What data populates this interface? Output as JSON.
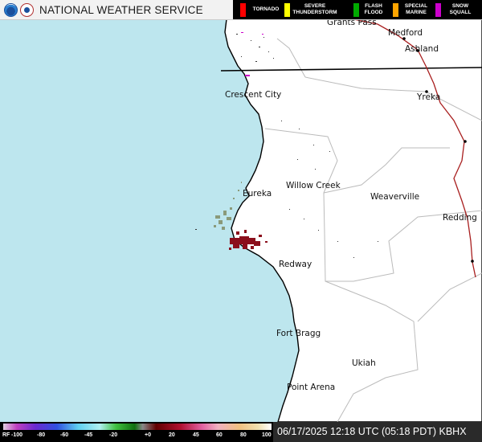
{
  "header": {
    "title": "NATIONAL WEATHER SERVICE",
    "logos": [
      "noaa-logo",
      "nws-logo"
    ]
  },
  "warnings_legend": [
    {
      "label": "TORNADO",
      "color": "#ff0000"
    },
    {
      "label": "SEVERE\nTHUNDERSTORM",
      "color": "#ffff00"
    },
    {
      "label": "FLASH\nFLOOD",
      "color": "#00aa00"
    },
    {
      "label": "SPECIAL\nMARINE",
      "color": "#ffa500"
    },
    {
      "label": "SNOW\nSQUALL",
      "color": "#cc00cc"
    }
  ],
  "cities": {
    "grants_pass": "Grants Pass",
    "medford": "Medford",
    "ashland": "Ashland",
    "crescent_city": "Crescent City",
    "yreka": "Yreka",
    "willow_creek": "Willow Creek",
    "eureka": "Eureka",
    "weaverville": "Weaverville",
    "redding": "Redding",
    "redway": "Redway",
    "fort_bragg": "Fort Bragg",
    "ukiah": "Ukiah",
    "point_arena": "Point Arena"
  },
  "reflectivity_scale": {
    "prefix": "RF",
    "ticks": [
      "-100",
      "-80",
      "-60",
      "-45",
      "-20",
      "+0",
      "20",
      "45",
      "60",
      "80",
      "100"
    ]
  },
  "timestamp": "06/17/2025 12:18 UTC (05:18 PDT) KBHX",
  "colors": {
    "ocean": "#bde6ee",
    "land": "#ffffff",
    "coast": "#000000",
    "interstate": "#a81e1e",
    "borders": "#bbbbbb",
    "echo_dark_red": "#8b0f1c",
    "echo_gray_green": "#8a9a7a"
  }
}
